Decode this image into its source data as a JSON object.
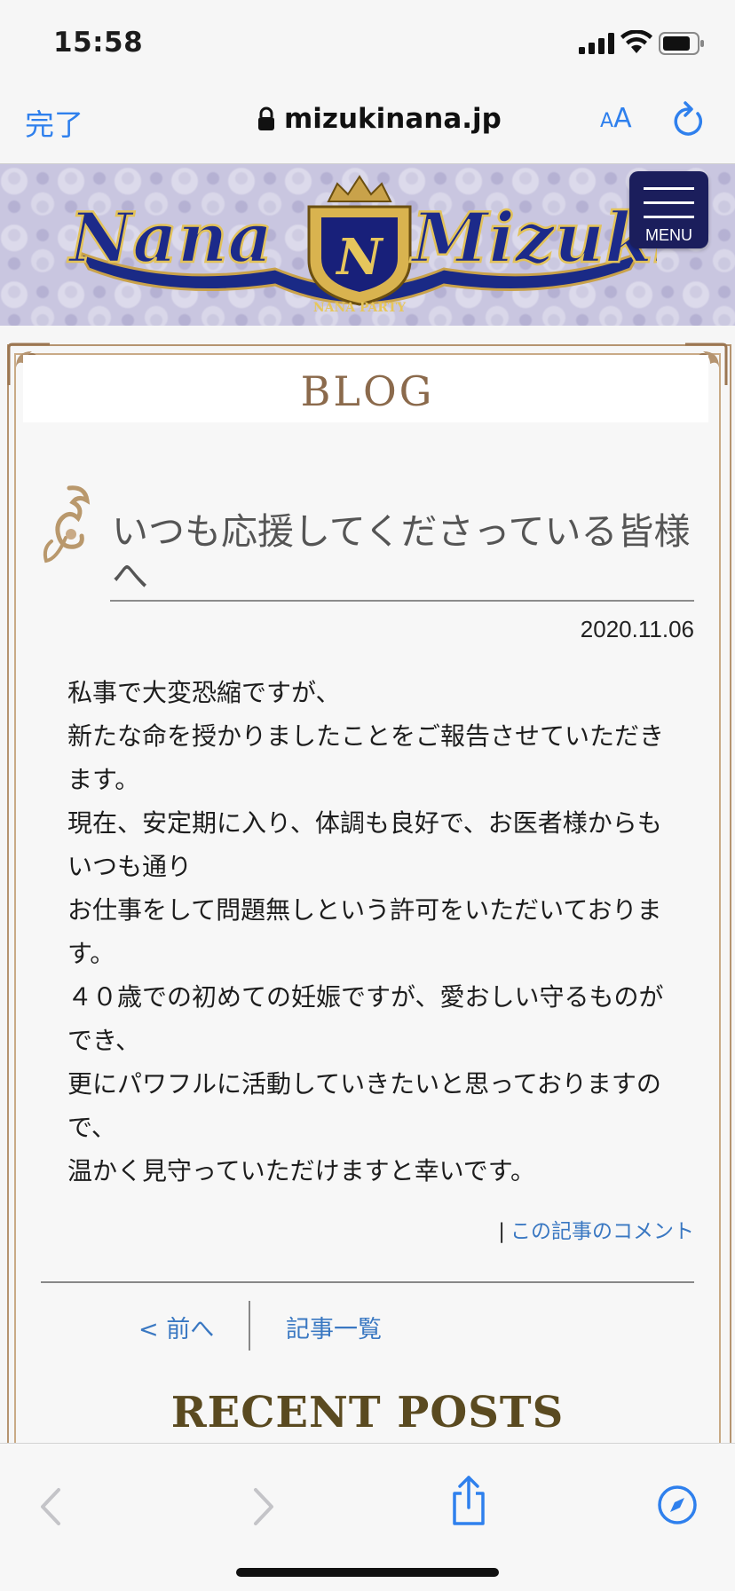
{
  "status_bar": {
    "time": "15:58",
    "icons": [
      "signal-icon",
      "wifi-icon",
      "battery-icon"
    ]
  },
  "browser": {
    "done_label": "完了",
    "url": "mizukinana.jp",
    "text_size_small": "A",
    "text_size_large": "A",
    "icons": [
      "lock-icon",
      "reload-icon",
      "back-icon",
      "forward-icon",
      "share-icon",
      "compass-icon"
    ],
    "accent_color": "#2f80ed"
  },
  "site": {
    "logo_text_left": "Nana",
    "logo_text_right": "Mizuki",
    "logo_emblem_letter": "N",
    "logo_ribbon": "NANA PARTY",
    "menu_label": "MENU"
  },
  "blog": {
    "heading": "BLOG",
    "post": {
      "title": "いつも応援してくださっている皆様へ",
      "date": "2020.11.06",
      "body": [
        "私事で大変恐縮ですが、",
        "新たな命を授かりましたことをご報告させていただきます。",
        "現在、安定期に入り、体調も良好で、お医者様からもいつも通り",
        "お仕事をして問題無しという許可をいただいております。",
        "４０歳での初めての妊娠ですが、愛おしい守るものができ、",
        "更にパワフルに活動していきたいと思っておりますので、",
        "温かく見守っていただけますと幸いです。"
      ],
      "comment_separator": "|",
      "comment_link": "この記事のコメント"
    },
    "nav": {
      "prev_label": "< 前へ",
      "list_label": "記事一覧"
    },
    "recent_heading": "RECENT POSTS"
  }
}
